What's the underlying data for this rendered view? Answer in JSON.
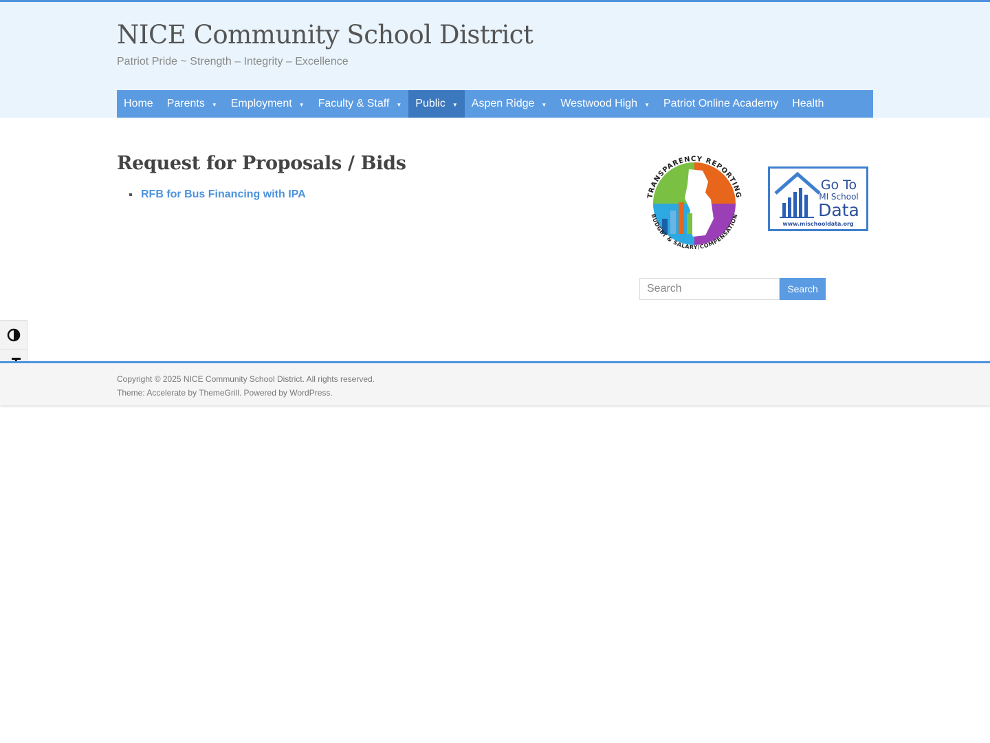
{
  "site": {
    "title": "NICE Community School District",
    "tagline": "Patriot Pride ~ Strength – Integrity – Excellence"
  },
  "colors": {
    "accent": "#4d93dd",
    "nav_bg": "#5b9be2",
    "nav_active": "#3b78be",
    "header_bg": "#eaf4fc"
  },
  "nav": {
    "items": [
      {
        "label": "Home",
        "has_dropdown": false,
        "active": false
      },
      {
        "label": "Parents",
        "has_dropdown": true,
        "active": false
      },
      {
        "label": "Employment",
        "has_dropdown": true,
        "active": false
      },
      {
        "label": "Faculty & Staff",
        "has_dropdown": true,
        "active": false
      },
      {
        "label": "Public",
        "has_dropdown": true,
        "active": true
      },
      {
        "label": "Aspen Ridge",
        "has_dropdown": true,
        "active": false
      },
      {
        "label": "Westwood High",
        "has_dropdown": true,
        "active": false
      },
      {
        "label": "Patriot Online Academy",
        "has_dropdown": false,
        "active": false
      },
      {
        "label": "Health",
        "has_dropdown": false,
        "active": false
      }
    ],
    "caret": "▼"
  },
  "main": {
    "title": "Request for Proposals / Bids",
    "links": [
      {
        "label": "RFB for Bus Financing with IPA"
      }
    ]
  },
  "sidebar": {
    "transparency_badge": {
      "top_text": "TRANSPARENCY REPORTING",
      "bottom_text": "BUDGET & SALARY/COMPENSATION",
      "icon": "michigan-map-chart-icon"
    },
    "mischooldata_badge": {
      "line1": "Go To",
      "line2": "MI School",
      "line3": "Data",
      "url_text": "www.mischooldata.org",
      "icon": "house-bar-chart-icon"
    },
    "search": {
      "placeholder": "Search",
      "button_label": "Search"
    }
  },
  "accessibility_toolbar": {
    "contrast_icon": "contrast-icon",
    "font_size_icon": "font-size-icon"
  },
  "footer": {
    "copyright_prefix": "Copyright © 2025 ",
    "copyright_link": "NICE Community School District",
    "copyright_suffix": ". All rights reserved.",
    "theme_prefix": "Theme: ",
    "theme_link": "Accelerate",
    "by_text": " by ",
    "themegrill_link": "ThemeGrill",
    "powered_text": ". Powered by ",
    "wordpress_link": "WordPress",
    "end_text": "."
  }
}
